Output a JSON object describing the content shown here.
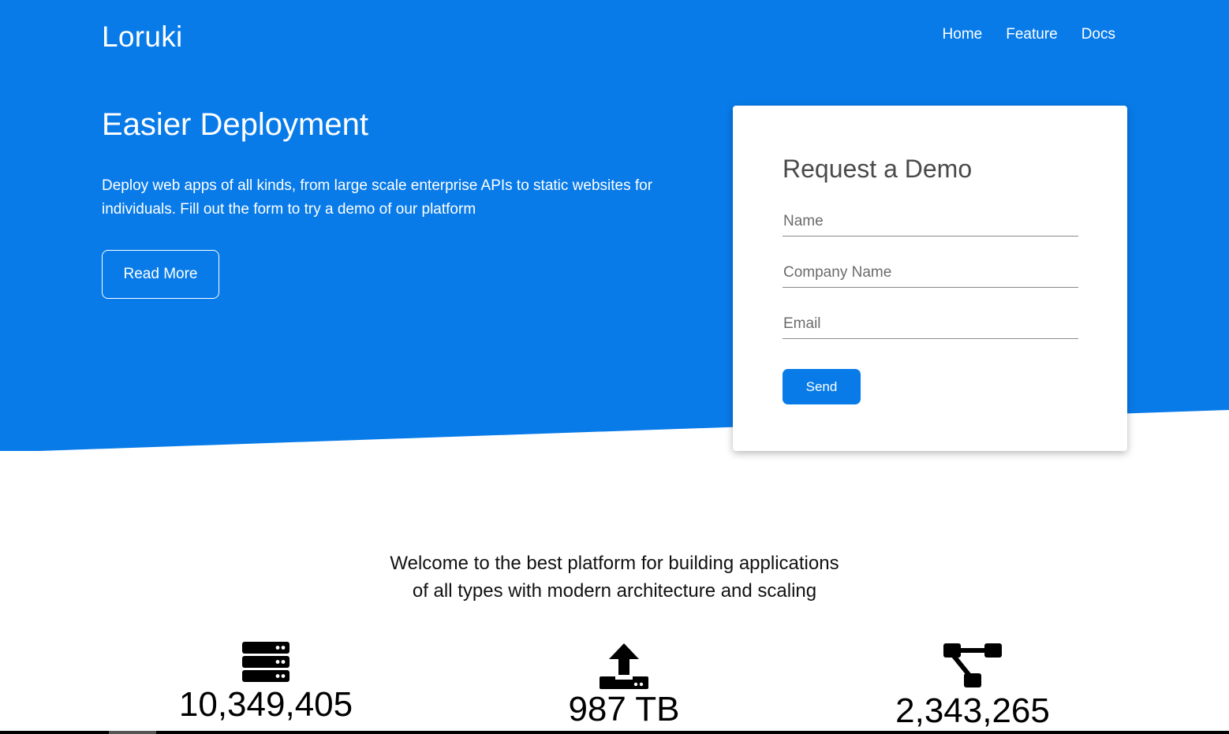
{
  "colors": {
    "brand_blue": "#087be9",
    "white": "#ffffff",
    "text_dark": "#111111"
  },
  "header": {
    "brand": "Loruki",
    "nav": [
      {
        "label": "Home"
      },
      {
        "label": "Feature"
      },
      {
        "label": "Docs"
      }
    ]
  },
  "hero": {
    "title": "Easier Deployment",
    "text": "Deploy web apps of all kinds, from large scale enterprise APIs to static websites for individuals. Fill out the form to try a demo of our platform",
    "read_more_label": "Read More"
  },
  "demo_form": {
    "title": "Request a Demo",
    "name_placeholder": "Name",
    "company_placeholder": "Company Name",
    "email_placeholder": "Email",
    "send_label": "Send"
  },
  "welcome": {
    "line1": "Welcome to the best platform for building applications",
    "line2": "of all types with modern architecture and scaling"
  },
  "stats": [
    {
      "icon": "server-icon",
      "value": "10,349,405"
    },
    {
      "icon": "upload-icon",
      "value": "987 TB"
    },
    {
      "icon": "project-diagram-icon",
      "value": "2,343,265"
    }
  ]
}
